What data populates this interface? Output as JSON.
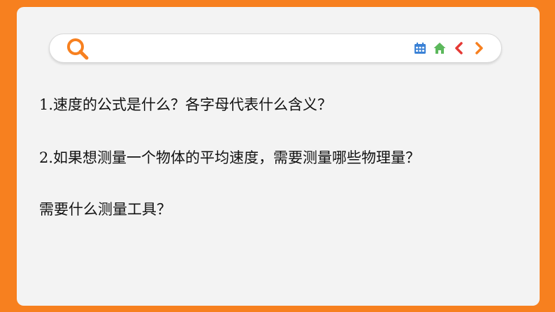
{
  "colors": {
    "background": "#f7801f",
    "card": "#f3f3f3",
    "search_icon": "#f7801f",
    "calendar_icon": "#3b82d6",
    "home_icon": "#5cb85c",
    "back_icon": "#e53935",
    "forward_icon": "#f7801f"
  },
  "icons": {
    "search": "search-icon",
    "calendar": "calendar-icon",
    "home": "home-icon",
    "back": "chevron-left-icon",
    "forward": "chevron-right-icon"
  },
  "questions": [
    "1.速度的公式是什么？各字母代表什么含义？",
    "2.如果想测量一个物体的平均速度，需要测量哪些物理量？",
    "需要什么测量工具？"
  ]
}
